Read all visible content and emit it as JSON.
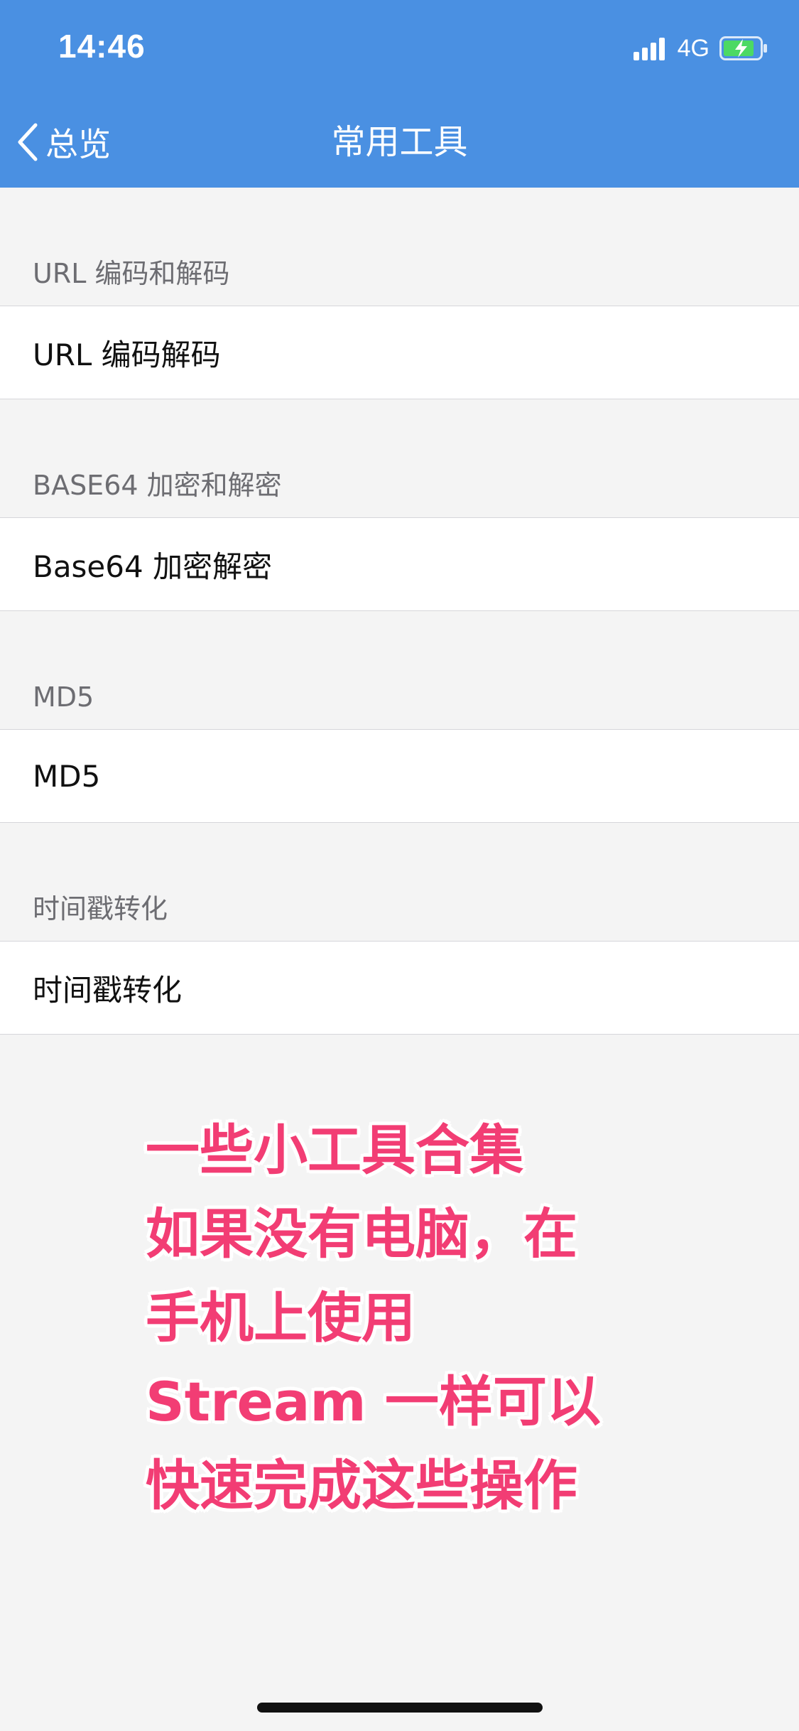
{
  "status_bar": {
    "time": "14:46",
    "network": "4G",
    "battery_charging": true,
    "battery_color": "#4cd964"
  },
  "nav": {
    "back_label": "总览",
    "title": "常用工具",
    "background_color": "#4a90e2"
  },
  "sections": [
    {
      "header": "URL 编码和解码",
      "item": "URL 编码解码"
    },
    {
      "header": "BASE64 加密和解密",
      "item": "Base64 加密解密"
    },
    {
      "header": "MD5",
      "item": "MD5"
    },
    {
      "header": "时间戳转化",
      "item": "时间戳转化"
    }
  ],
  "caption": {
    "lines": [
      "一些小工具合集",
      "如果没有电脑，在",
      "手机上使用",
      "Stream 一样可以",
      "快速完成这些操作"
    ],
    "color": "#f23d74"
  },
  "icons": {
    "back": "chevron-left-icon",
    "signal": "cellular-signal-icon",
    "battery": "battery-charging-icon"
  }
}
